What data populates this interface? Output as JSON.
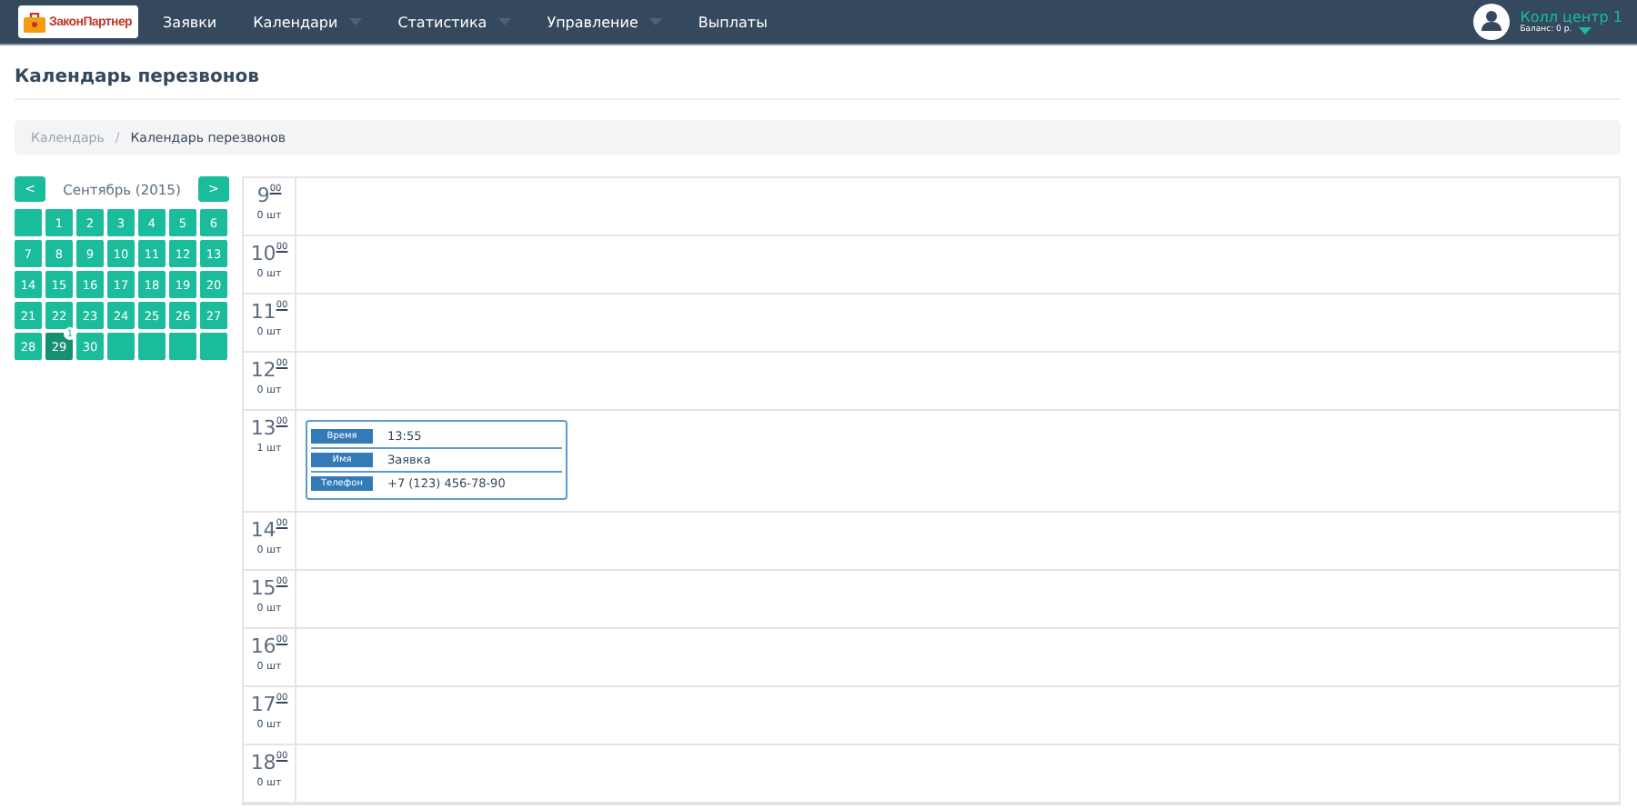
{
  "navbar": {
    "logo": "ЗаконПартнер",
    "menu": [
      {
        "label": "Заявки",
        "dropdown": false
      },
      {
        "label": "Календари",
        "dropdown": true
      },
      {
        "label": "Статистика",
        "dropdown": true
      },
      {
        "label": "Управление",
        "dropdown": true
      },
      {
        "label": "Выплаты",
        "dropdown": false
      }
    ],
    "user": {
      "name": "Колл центр 1",
      "balance": "Баланс: 0 р."
    }
  },
  "page_title": "Календарь перезвонов",
  "breadcrumb": {
    "separator": "/",
    "items": [
      {
        "label": "Календарь",
        "current": false
      },
      {
        "label": "Календарь перезвонов",
        "current": true
      }
    ]
  },
  "calendar": {
    "prev": "<",
    "next": ">",
    "month": "Сентябрь (2015)",
    "days": [
      {
        "kind": "blank"
      },
      {
        "kind": "day",
        "label": "1",
        "selected": false
      },
      {
        "kind": "day",
        "label": "2",
        "selected": false
      },
      {
        "kind": "day",
        "label": "3",
        "selected": false
      },
      {
        "kind": "day",
        "label": "4",
        "selected": false
      },
      {
        "kind": "day",
        "label": "5",
        "selected": false
      },
      {
        "kind": "day",
        "label": "6",
        "selected": false
      },
      {
        "kind": "day",
        "label": "7",
        "selected": false
      },
      {
        "kind": "day",
        "label": "8",
        "selected": false
      },
      {
        "kind": "day",
        "label": "9",
        "selected": false
      },
      {
        "kind": "day",
        "label": "10",
        "selected": false
      },
      {
        "kind": "day",
        "label": "11",
        "selected": false
      },
      {
        "kind": "day",
        "label": "12",
        "selected": false
      },
      {
        "kind": "day",
        "label": "13",
        "selected": false
      },
      {
        "kind": "day",
        "label": "14",
        "selected": false
      },
      {
        "kind": "day",
        "label": "15",
        "selected": false
      },
      {
        "kind": "day",
        "label": "16",
        "selected": false
      },
      {
        "kind": "day",
        "label": "17",
        "selected": false
      },
      {
        "kind": "day",
        "label": "18",
        "selected": false
      },
      {
        "kind": "day",
        "label": "19",
        "selected": false
      },
      {
        "kind": "day",
        "label": "20",
        "selected": false
      },
      {
        "kind": "day",
        "label": "21",
        "selected": false
      },
      {
        "kind": "day",
        "label": "22",
        "selected": false
      },
      {
        "kind": "day",
        "label": "23",
        "selected": false
      },
      {
        "kind": "day",
        "label": "24",
        "selected": false
      },
      {
        "kind": "day",
        "label": "25",
        "selected": false
      },
      {
        "kind": "day",
        "label": "26",
        "selected": false
      },
      {
        "kind": "day",
        "label": "27",
        "selected": false
      },
      {
        "kind": "day",
        "label": "28",
        "selected": false
      },
      {
        "kind": "day",
        "label": "29",
        "selected": true,
        "badge": "1"
      },
      {
        "kind": "day",
        "label": "30",
        "selected": false
      },
      {
        "kind": "blank"
      },
      {
        "kind": "blank"
      },
      {
        "kind": "blank"
      },
      {
        "kind": "blank"
      }
    ]
  },
  "schedule": [
    {
      "hour": "9",
      "minutes": "00",
      "count": "0 шт"
    },
    {
      "hour": "10",
      "minutes": "00",
      "count": "0 шт"
    },
    {
      "hour": "11",
      "minutes": "00",
      "count": "0 шт"
    },
    {
      "hour": "12",
      "minutes": "00",
      "count": "0 шт"
    },
    {
      "hour": "13",
      "minutes": "00",
      "count": "1 шт",
      "entries": [
        {
          "fields": [
            {
              "label": "Время",
              "value": "13:55"
            },
            {
              "label": "Имя",
              "value": "Заявка"
            },
            {
              "label": "Телефон",
              "value": "+7 (123) 456-78-90"
            }
          ]
        }
      ]
    },
    {
      "hour": "14",
      "minutes": "00",
      "count": "0 шт"
    },
    {
      "hour": "15",
      "minutes": "00",
      "count": "0 шт"
    },
    {
      "hour": "16",
      "minutes": "00",
      "count": "0 шт"
    },
    {
      "hour": "17",
      "minutes": "00",
      "count": "0 шт"
    },
    {
      "hour": "18",
      "minutes": "00",
      "count": "0 шт"
    }
  ]
}
